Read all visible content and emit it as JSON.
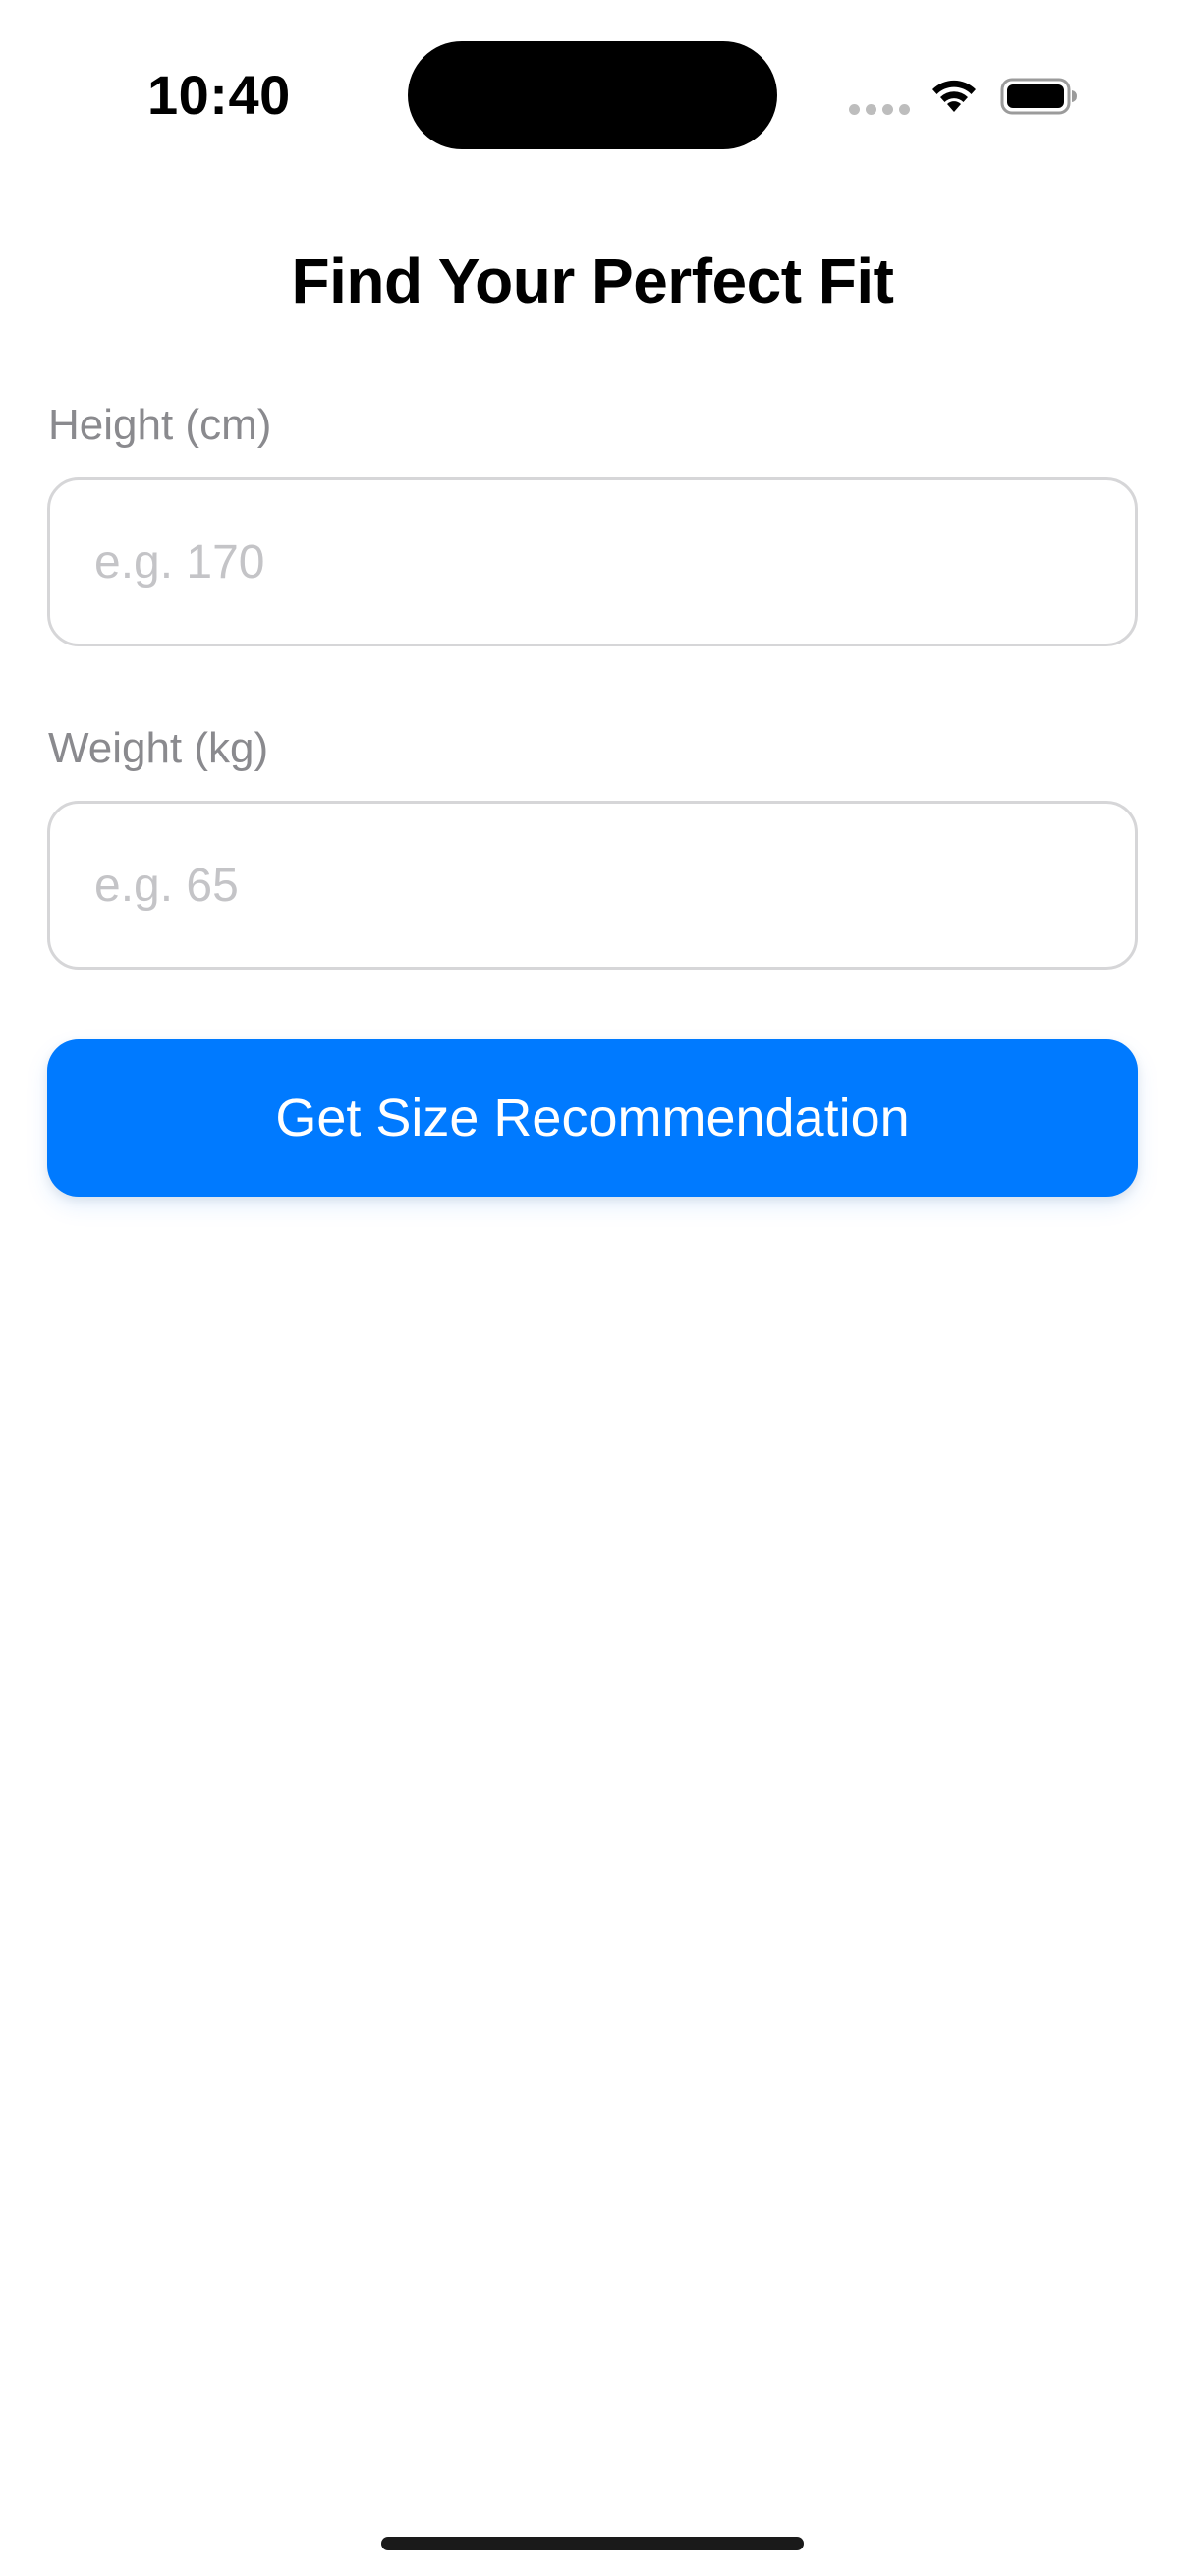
{
  "status_bar": {
    "time": "10:40"
  },
  "page": {
    "title": "Find Your Perfect Fit"
  },
  "form": {
    "height": {
      "label": "Height (cm)",
      "placeholder": "e.g. 170",
      "value": ""
    },
    "weight": {
      "label": "Weight (kg)",
      "placeholder": "e.g. 65",
      "value": ""
    },
    "submit_label": "Get Size Recommendation"
  },
  "colors": {
    "accent": "#007aff",
    "label_gray": "#8a8a8e",
    "placeholder_gray": "#c4c4c7",
    "input_border": "#d6d6d8"
  },
  "icons": {
    "wifi": "wifi-icon",
    "battery": "battery-icon",
    "signal": "cellular-signal-icon"
  }
}
